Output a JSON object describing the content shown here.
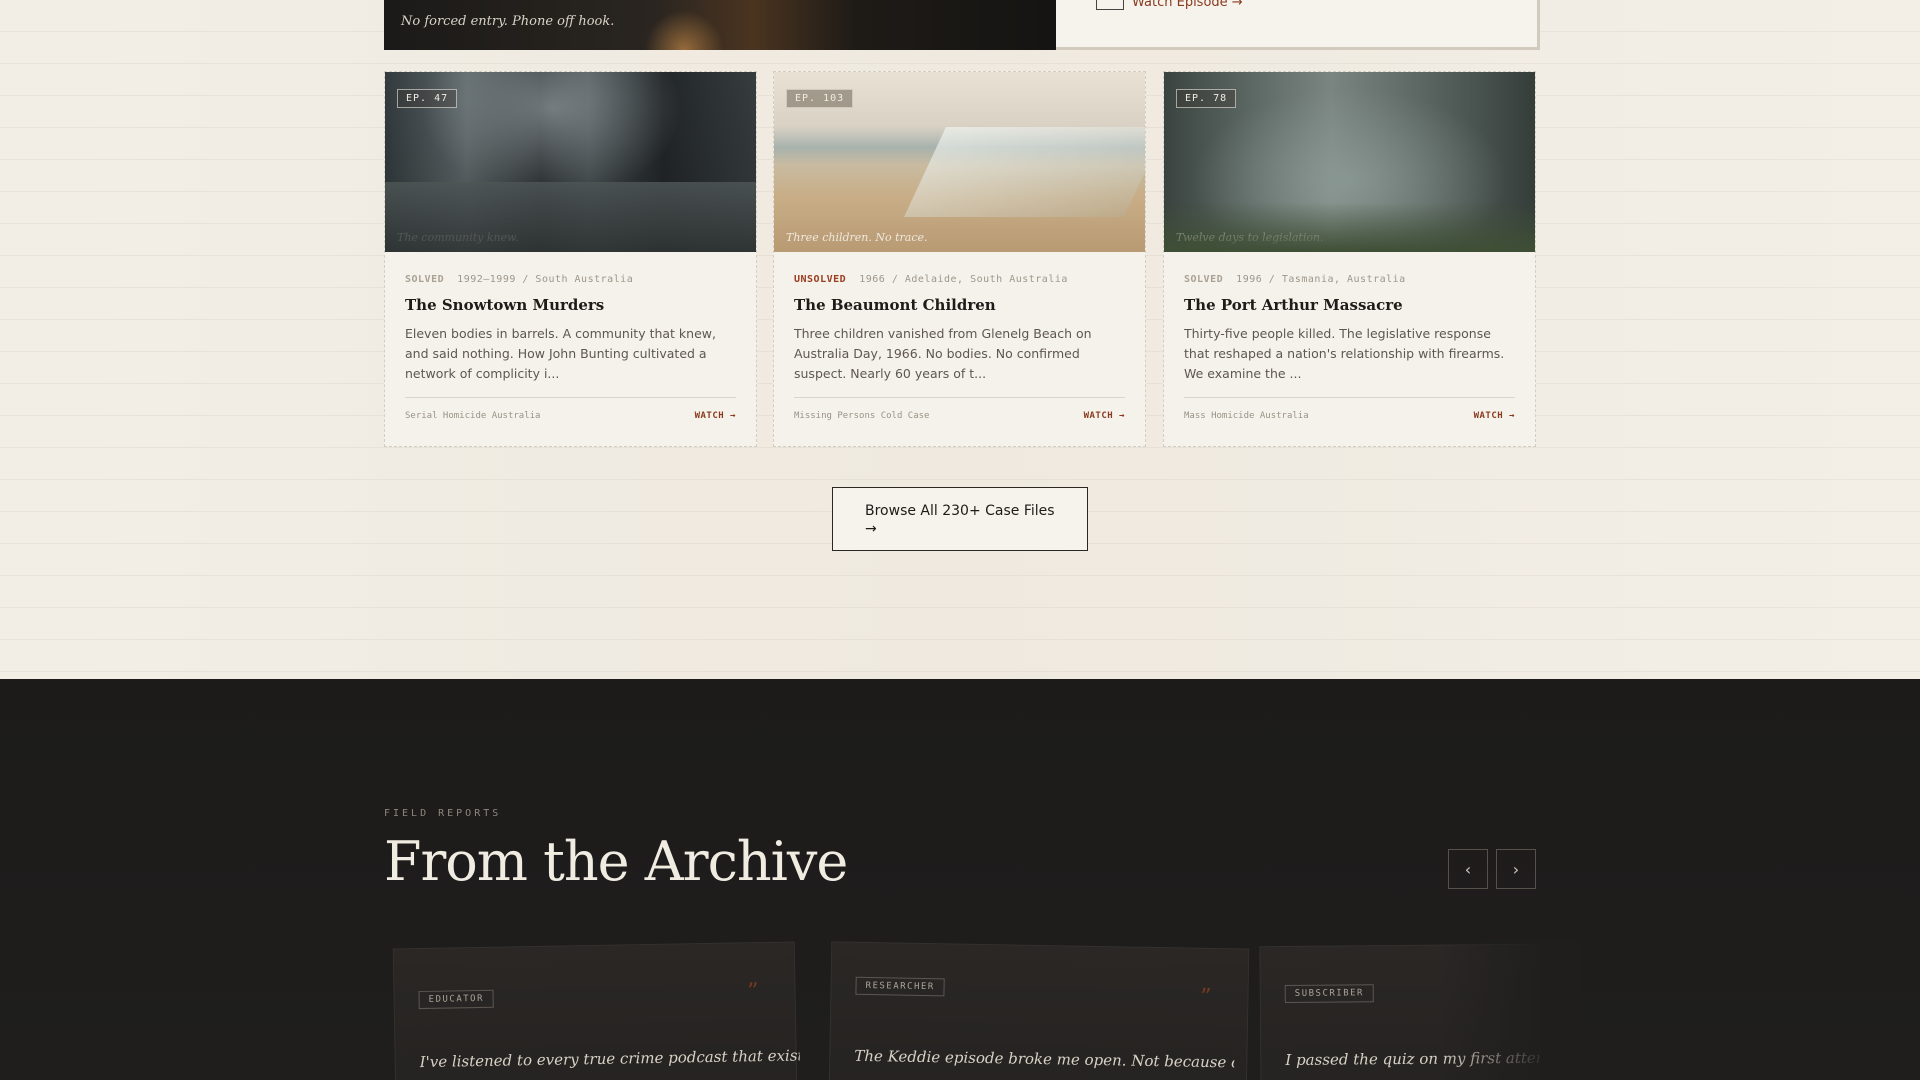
{
  "featured": {
    "caption": "No forced entry. Phone off hook.",
    "watch_label": "Watch Episode →"
  },
  "cards": [
    {
      "ep": "EP. 47",
      "caption": "The community knew.",
      "status": "SOLVED",
      "meta": "1992–1999 / South Australia",
      "title": "The Snowtown Murders",
      "desc": "Eleven bodies in barrels. A community that knew, and said nothing. How John Bunting cultivated a network of complicity i...",
      "tags": "Serial Homicide  Australia",
      "watch": "WATCH →"
    },
    {
      "ep": "EP. 103",
      "caption": "Three children. No trace.",
      "status": "UNSOLVED",
      "meta": "1966 / Adelaide, South Australia",
      "title": "The Beaumont Children",
      "desc": "Three children vanished from Glenelg Beach on Australia Day, 1966. No bodies. No confirmed suspect. Nearly 60 years of t...",
      "tags": "Missing Persons  Cold Case",
      "watch": "WATCH →"
    },
    {
      "ep": "EP. 78",
      "caption": "Twelve days to legislation.",
      "status": "SOLVED",
      "meta": "1996 / Tasmania, Australia",
      "title": "The Port Arthur Massacre",
      "desc": "Thirty-five people killed. The legislative response that reshaped a nation's relationship with firearms. We examine the ...",
      "tags": "Mass Homicide  Australia",
      "watch": "WATCH →"
    }
  ],
  "browse_label": "Browse All 230+ Case Files →",
  "archive": {
    "eyebrow": "FIELD REPORTS",
    "title": "From the Archive",
    "prev_icon": "‹",
    "next_icon": "›",
    "testimonials": [
      {
        "badge": "EDUCATOR",
        "quote_mark": "”",
        "text": "I've listened to every true crime podcast that exists."
      },
      {
        "badge": "RESEARCHER",
        "quote_mark": "”",
        "text": "The Keddie episode broke me open. Not because of"
      },
      {
        "badge": "SUBSCRIBER",
        "quote_mark": "”",
        "text": "I passed the quiz on my first attempt"
      }
    ]
  }
}
